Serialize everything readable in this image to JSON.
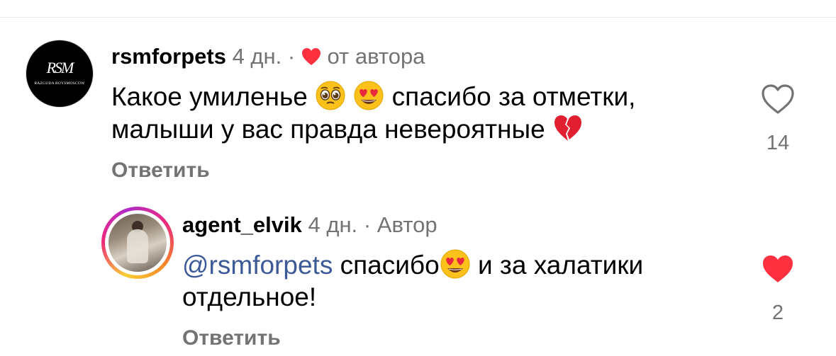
{
  "comments": [
    {
      "username": "rsmforpets",
      "time": "4 дн.",
      "separator": "·",
      "author_tag": "от автора",
      "avatar": {
        "monogram": "RSM",
        "subtext": "RAZGUDA ROYSMOSCOW"
      },
      "text_line1": "Какое умиленье",
      "text_line1_after": "спасибо за отметки,",
      "text_line2": "малыши у вас правда невероятные",
      "emojis": [
        "pleading-face",
        "heart-eyes-face",
        "broken-heart"
      ],
      "reply_label": "Ответить",
      "likes": "14",
      "liked": false
    },
    {
      "username": "agent_elvik",
      "time": "4 дн.",
      "separator": "·",
      "author_tag": "Автор",
      "mention": "@rsmforpets",
      "text_line1_a": "спасибо",
      "text_line1_b": "и за халатики",
      "text_line2": "отдельное!",
      "emojis": [
        "heart-eyes-face"
      ],
      "reply_label": "Ответить",
      "likes": "2",
      "liked": true
    }
  ],
  "colors": {
    "muted": "#737373",
    "mention": "#3d5a98",
    "heart_red": "#ff3040"
  }
}
